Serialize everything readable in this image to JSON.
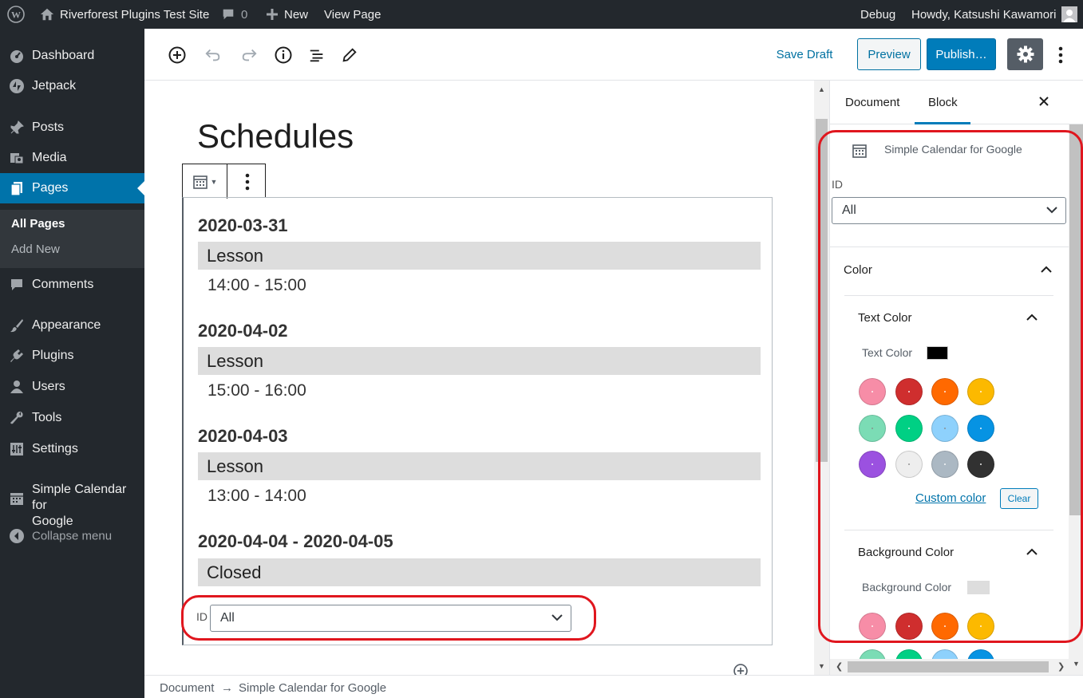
{
  "admin_bar": {
    "site_name": "Riverforest Plugins Test Site",
    "comments_count": "0",
    "new_label": "New",
    "view_page_label": "View Page",
    "debug_label": "Debug",
    "howdy_label": "Howdy, Katsushi Kawamori"
  },
  "sidebar": {
    "items": [
      {
        "label": "Dashboard",
        "icon": "dashboard-icon"
      },
      {
        "label": "Jetpack",
        "icon": "jetpack-icon"
      },
      {
        "label": "Posts",
        "icon": "pin-icon"
      },
      {
        "label": "Media",
        "icon": "media-icon"
      },
      {
        "label": "Pages",
        "icon": "pages-icon"
      },
      {
        "label": "Comments",
        "icon": "comments-icon"
      },
      {
        "label": "Appearance",
        "icon": "brush-icon"
      },
      {
        "label": "Plugins",
        "icon": "plugin-icon"
      },
      {
        "label": "Users",
        "icon": "users-icon"
      },
      {
        "label": "Tools",
        "icon": "wrench-icon"
      },
      {
        "label": "Settings",
        "icon": "settings-icon"
      },
      {
        "label_line1": "Simple Calendar for",
        "label_line2": "Google",
        "icon": "calendar-icon"
      },
      {
        "label": "Collapse menu",
        "icon": "collapse-icon"
      }
    ],
    "submenu": [
      "All Pages",
      "Add New"
    ]
  },
  "toolbar": {
    "save_draft": "Save Draft",
    "preview": "Preview",
    "publish": "Publish…"
  },
  "editor": {
    "title": "Schedules",
    "events": [
      {
        "date": "2020-03-31",
        "name": "Lesson",
        "time": "14:00 - 15:00"
      },
      {
        "date": "2020-04-02",
        "name": "Lesson",
        "time": "15:00 - 16:00"
      },
      {
        "date": "2020-04-03",
        "name": "Lesson",
        "time": "13:00 - 14:00"
      },
      {
        "date": "2020-04-04 - 2020-04-05",
        "name": "Closed",
        "time": ""
      }
    ],
    "id_label": "ID",
    "id_value": "All"
  },
  "settings_panel": {
    "tab_document": "Document",
    "tab_block": "Block",
    "block_name": "Simple Calendar for Google",
    "id_label": "ID",
    "id_value": "All",
    "color_section": "Color",
    "text_color_title": "Text Color",
    "text_color_label": "Text Color",
    "text_color_value": "#000000",
    "custom_color": "Custom color",
    "clear": "Clear",
    "bg_color_title": "Background Color",
    "bg_color_label": "Background Color",
    "bg_color_value": "#dddddd",
    "palette": [
      "#f78da7",
      "#cf2e2e",
      "#ff6900",
      "#fcb900",
      "#7bdcb5",
      "#00d084",
      "#8ed1fc",
      "#0693e3",
      "#9b51e0",
      "#eeeeee",
      "#abb8c3",
      "#313131"
    ]
  },
  "footer": {
    "breadcrumb_root": "Document",
    "arrow": "→",
    "breadcrumb_leaf": "Simple Calendar for Google"
  }
}
